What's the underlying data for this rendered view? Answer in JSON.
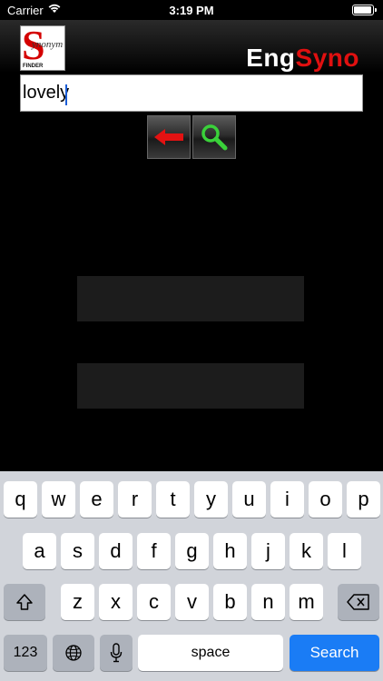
{
  "status_bar": {
    "carrier": "Carrier",
    "time": "3:19 PM"
  },
  "header": {
    "logo": {
      "letter": "S",
      "text": "ynonym",
      "sub": "FINDER"
    },
    "brand_left": "Eng",
    "brand_right": "Syno"
  },
  "search": {
    "value": "lovely"
  },
  "buttons": {
    "back": "back-arrow-icon",
    "search": "magnifier-icon"
  },
  "colors": {
    "brand_red": "#e01010",
    "search_green": "#3ad13a",
    "key_blue": "#1a7cf5"
  },
  "keyboard": {
    "row1": [
      "q",
      "w",
      "e",
      "r",
      "t",
      "y",
      "u",
      "i",
      "o",
      "p"
    ],
    "row2": [
      "a",
      "s",
      "d",
      "f",
      "g",
      "h",
      "j",
      "k",
      "l"
    ],
    "row3": [
      "z",
      "x",
      "c",
      "v",
      "b",
      "n",
      "m"
    ],
    "numbers_label": "123",
    "space_label": "space",
    "action_label": "Search"
  }
}
